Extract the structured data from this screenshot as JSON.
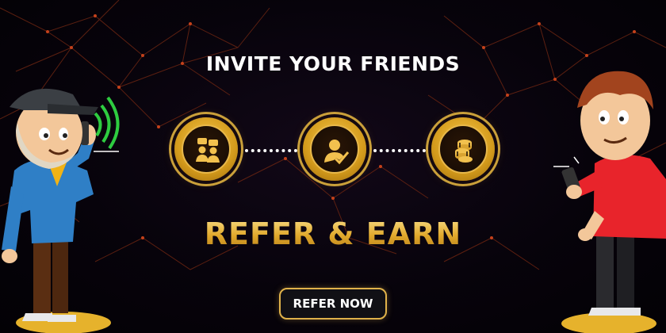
{
  "banner": {
    "title": "INVITE YOUR FRIENDS",
    "headline": "REFER & EARN",
    "cta_label": "REFER NOW"
  },
  "steps": [
    {
      "icon": "chat-people-icon"
    },
    {
      "icon": "user-check-icon"
    },
    {
      "icon": "poker-chips-icon"
    }
  ],
  "colors": {
    "background": "#07030b",
    "gold": "#e0a82b",
    "network_lines": "#7a2a14",
    "left_person_shirt": "#2f7fc6",
    "right_person_shirt": "#e8242b"
  }
}
